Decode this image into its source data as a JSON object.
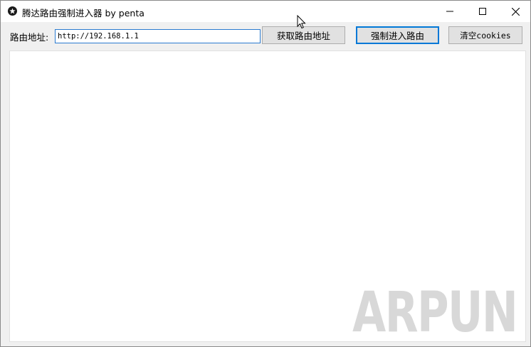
{
  "window": {
    "title": "腾达路由强制进入器 by penta",
    "controls": {
      "minimize": "minimize",
      "maximize": "maximize",
      "close": "close"
    }
  },
  "toolbar": {
    "address_label": "路由地址:",
    "address_value": "http://192.168.1.1",
    "get_address_label": "获取路由地址",
    "force_enter_label": "强制进入路由",
    "clear_cookies_label": "清空cookies"
  },
  "watermark": {
    "text": "ARPUN"
  },
  "icons": {
    "app": "star-badge-icon",
    "minimize": "minimize-icon",
    "maximize": "maximize-icon",
    "close": "close-icon",
    "cursor": "mouse-cursor-icon"
  },
  "colors": {
    "focus_border": "#0078d7",
    "button_face": "#e1e1e1",
    "window_bg": "#f0f0f0"
  }
}
